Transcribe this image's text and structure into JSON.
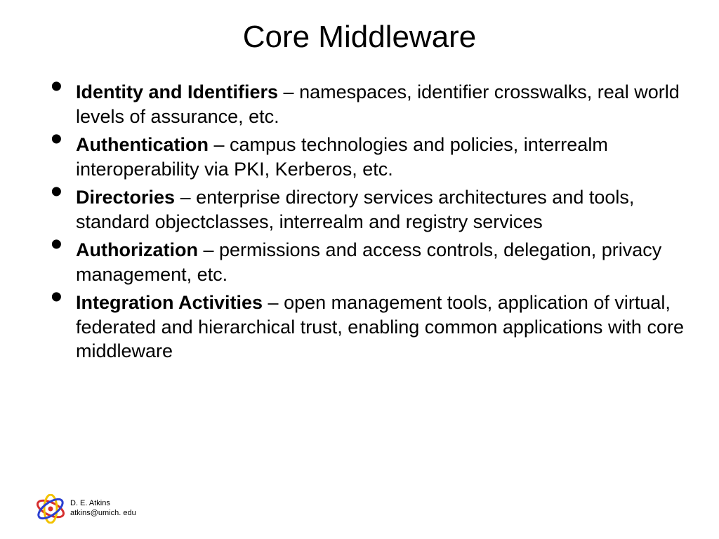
{
  "title": "Core Middleware",
  "bullets": [
    {
      "bold": "Identity and Identifiers",
      "rest": " – namespaces, identifier crosswalks, real world levels of assurance, etc."
    },
    {
      "bold": "Authentication",
      "rest": " – campus technologies and policies, interrealm interoperability via PKI, Kerberos, etc."
    },
    {
      "bold": "Directories",
      "rest": " – enterprise directory services architectures and tools, standard objectclasses, interrealm and registry services"
    },
    {
      "bold": "Authorization",
      "rest": " – permissions and access controls, delegation, privacy management, etc."
    },
    {
      "bold": "Integration Activities",
      "rest": " – open management tools, application of virtual, federated and hierarchical trust, enabling common applications with core middleware"
    }
  ],
  "footer": {
    "line1": "D. E. Atkins",
    "line2": "atkins@umich. edu"
  }
}
